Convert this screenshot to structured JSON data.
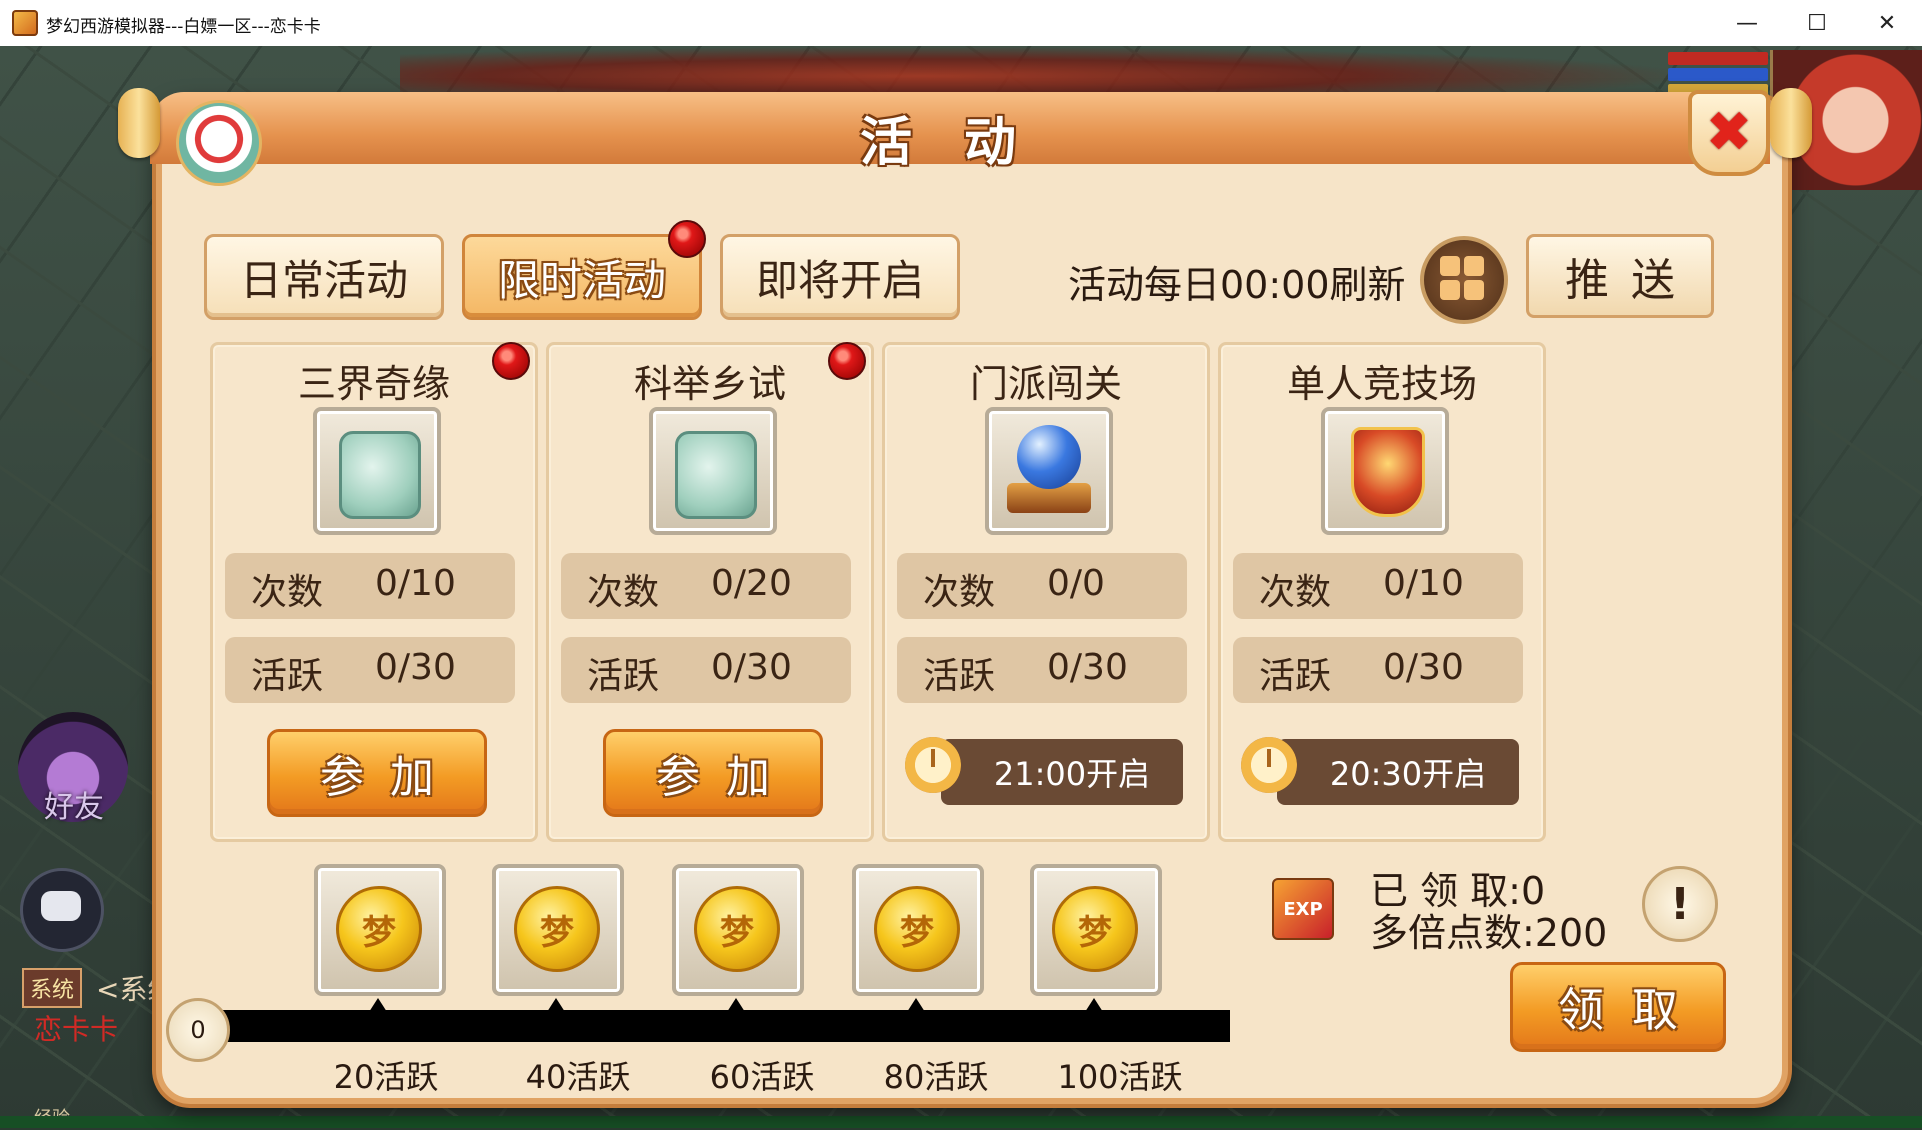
{
  "window": {
    "title": "梦幻西游模拟器---白嫖一区---恋卡卡",
    "minimize": "—",
    "maximize": "☐",
    "close": "✕"
  },
  "background": {
    "friends_label": "好友",
    "system_tag": "系统",
    "system_text": "<系统",
    "system_name": "恋卡卡",
    "exp_label": "经验"
  },
  "panel": {
    "title": "活动",
    "close_glyph": "✖"
  },
  "tabs": [
    {
      "label": "日常活动",
      "active": false,
      "badge": false
    },
    {
      "label": "限时活动",
      "active": true,
      "badge": true
    },
    {
      "label": "即将开启",
      "active": false,
      "badge": false
    }
  ],
  "refresh_text": "活动每日00:00刷新",
  "push_label": "推送",
  "cards": [
    {
      "title": "三界奇缘",
      "icon": "jade-token-icon",
      "badge": true,
      "count_label": "次数",
      "count": "0/10",
      "activity_label": "活跃",
      "activity": "0/30",
      "action": "参加"
    },
    {
      "title": "科举乡试",
      "icon": "jade-token-icon",
      "badge": true,
      "count_label": "次数",
      "count": "0/20",
      "activity_label": "活跃",
      "activity": "0/30",
      "action": "参加"
    },
    {
      "title": "门派闯关",
      "icon": "crystal-orb-icon",
      "badge": false,
      "count_label": "次数",
      "count": "0/0",
      "activity_label": "活跃",
      "activity": "0/30",
      "opens": "21:00开启"
    },
    {
      "title": "单人竞技场",
      "icon": "battle-shield-icon",
      "badge": false,
      "count_label": "次数",
      "count": "0/10",
      "activity_label": "活跃",
      "activity": "0/30",
      "opens": "20:30开启"
    }
  ],
  "rewards": {
    "current": "0",
    "coin_glyph": "梦",
    "progress_fraction": 0,
    "milestones": [
      "20活跃",
      "40活跃",
      "60活跃",
      "80活跃",
      "100活跃"
    ],
    "exp_icon_text": "EXP",
    "claimed": "已 领 取:0",
    "multiplier": "多倍点数:200",
    "info_glyph": "!",
    "claim_label": "领取"
  },
  "colors": {
    "accent_orange": "#f39b24",
    "panel_bg": "#f6e4c8",
    "badge_red": "#e01818"
  }
}
